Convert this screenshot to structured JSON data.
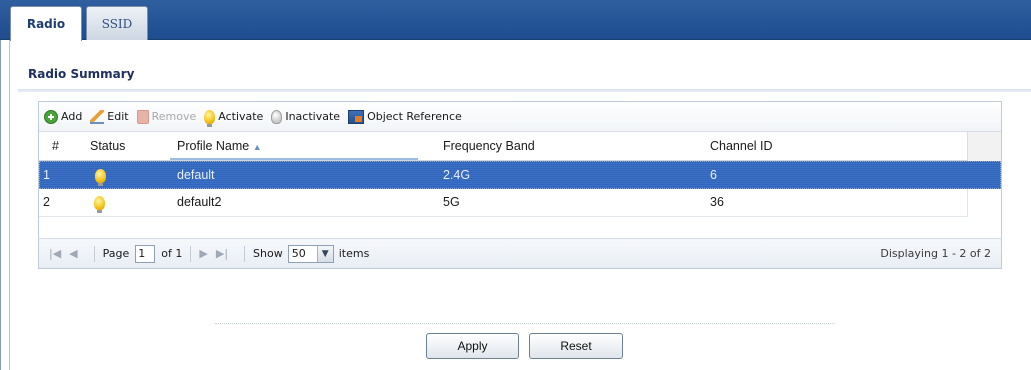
{
  "tabs": [
    {
      "label": "Radio",
      "active": true
    },
    {
      "label": "SSID",
      "active": false
    }
  ],
  "section_title": "Radio Summary",
  "toolbar": {
    "add": "Add",
    "edit": "Edit",
    "remove": "Remove",
    "activate": "Activate",
    "inactivate": "Inactivate",
    "object_reference": "Object Reference"
  },
  "table": {
    "columns": [
      "#",
      "Status",
      "Profile Name",
      "Frequency Band",
      "Channel ID"
    ],
    "sort_indicator": "▲",
    "rows": [
      {
        "index": "1",
        "status": "active",
        "profile_name": "default",
        "frequency_band": "2.4G",
        "channel_id": "6",
        "selected": true
      },
      {
        "index": "2",
        "status": "active",
        "profile_name": "default2",
        "frequency_band": "5G",
        "channel_id": "36",
        "selected": false
      }
    ]
  },
  "pager": {
    "first": "|◀",
    "prev": "◀",
    "page_label": "Page",
    "page_value": "1",
    "of_label": "of 1",
    "next": "▶",
    "last": "▶|",
    "show_label": "Show",
    "show_value": "50",
    "items_label": "items",
    "display_text": "Displaying 1 - 2 of 2"
  },
  "buttons": {
    "apply": "Apply",
    "reset": "Reset"
  },
  "colors": {
    "selected_row": "#3366bb",
    "tab_bar": "#2f5f9f"
  }
}
